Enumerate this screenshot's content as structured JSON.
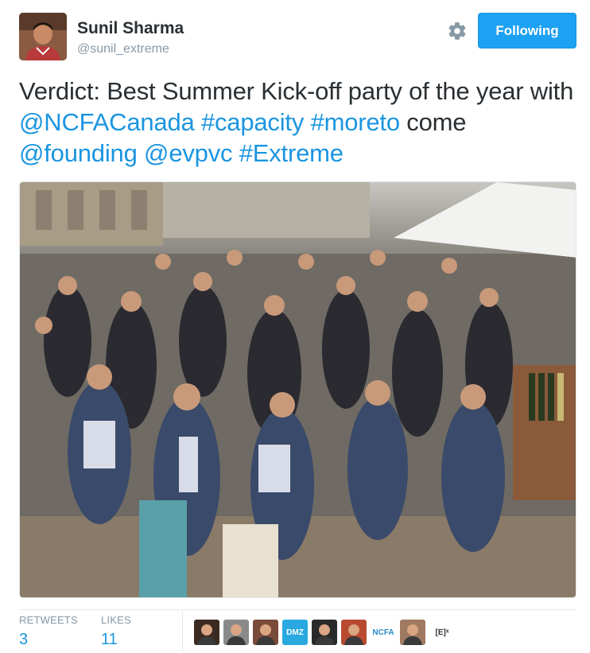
{
  "user": {
    "name": "Sunil Sharma",
    "handle": "@sunil_extreme"
  },
  "follow_button": {
    "label": "Following"
  },
  "tweet": {
    "segments": [
      {
        "text": "Verdict: Best Summer Kick-off party of the year with ",
        "link": false
      },
      {
        "text": "@NCFACanada",
        "link": true
      },
      {
        "text": " ",
        "link": false
      },
      {
        "text": "#capacity",
        "link": true
      },
      {
        "text": " ",
        "link": false
      },
      {
        "text": "#moreto",
        "link": true
      },
      {
        "text": " come ",
        "link": false
      },
      {
        "text": "@founding",
        "link": true
      },
      {
        "text": " ",
        "link": false
      },
      {
        "text": "@evpvc",
        "link": true
      },
      {
        "text": " ",
        "link": false
      },
      {
        "text": "#Extreme",
        "link": true
      }
    ]
  },
  "stats": {
    "retweets_label": "RETWEETS",
    "retweets_value": "3",
    "likes_label": "LIKES",
    "likes_value": "11"
  },
  "likers": [
    {
      "name": "liker-avatar-1",
      "label": "",
      "bg": "#3b2a22",
      "fg": "#ffffff"
    },
    {
      "name": "liker-avatar-2",
      "label": "",
      "bg": "#8a8a8a",
      "fg": "#ffffff"
    },
    {
      "name": "liker-avatar-3",
      "label": "",
      "bg": "#7a4a3a",
      "fg": "#ffffff"
    },
    {
      "name": "liker-avatar-dmz",
      "label": "DMZ",
      "bg": "#29a9e0",
      "fg": "#ffffff"
    },
    {
      "name": "liker-avatar-5",
      "label": "",
      "bg": "#2a2a2a",
      "fg": "#ffffff"
    },
    {
      "name": "liker-avatar-6",
      "label": "",
      "bg": "#b84a30",
      "fg": "#ffffff"
    },
    {
      "name": "liker-avatar-ncfa",
      "label": "NCFA",
      "bg": "#ffffff",
      "fg": "#2a8ac8"
    },
    {
      "name": "liker-avatar-8",
      "label": "",
      "bg": "#a07a60",
      "fg": "#ffffff"
    },
    {
      "name": "liker-avatar-e",
      "label": "[E]ˣ",
      "bg": "#ffffff",
      "fg": "#333333"
    }
  ],
  "colors": {
    "link": "#1b95e0",
    "button": "#1da1f2",
    "muted": "#8899a6",
    "text": "#292f33"
  },
  "icons": {
    "settings": "gear-icon"
  }
}
